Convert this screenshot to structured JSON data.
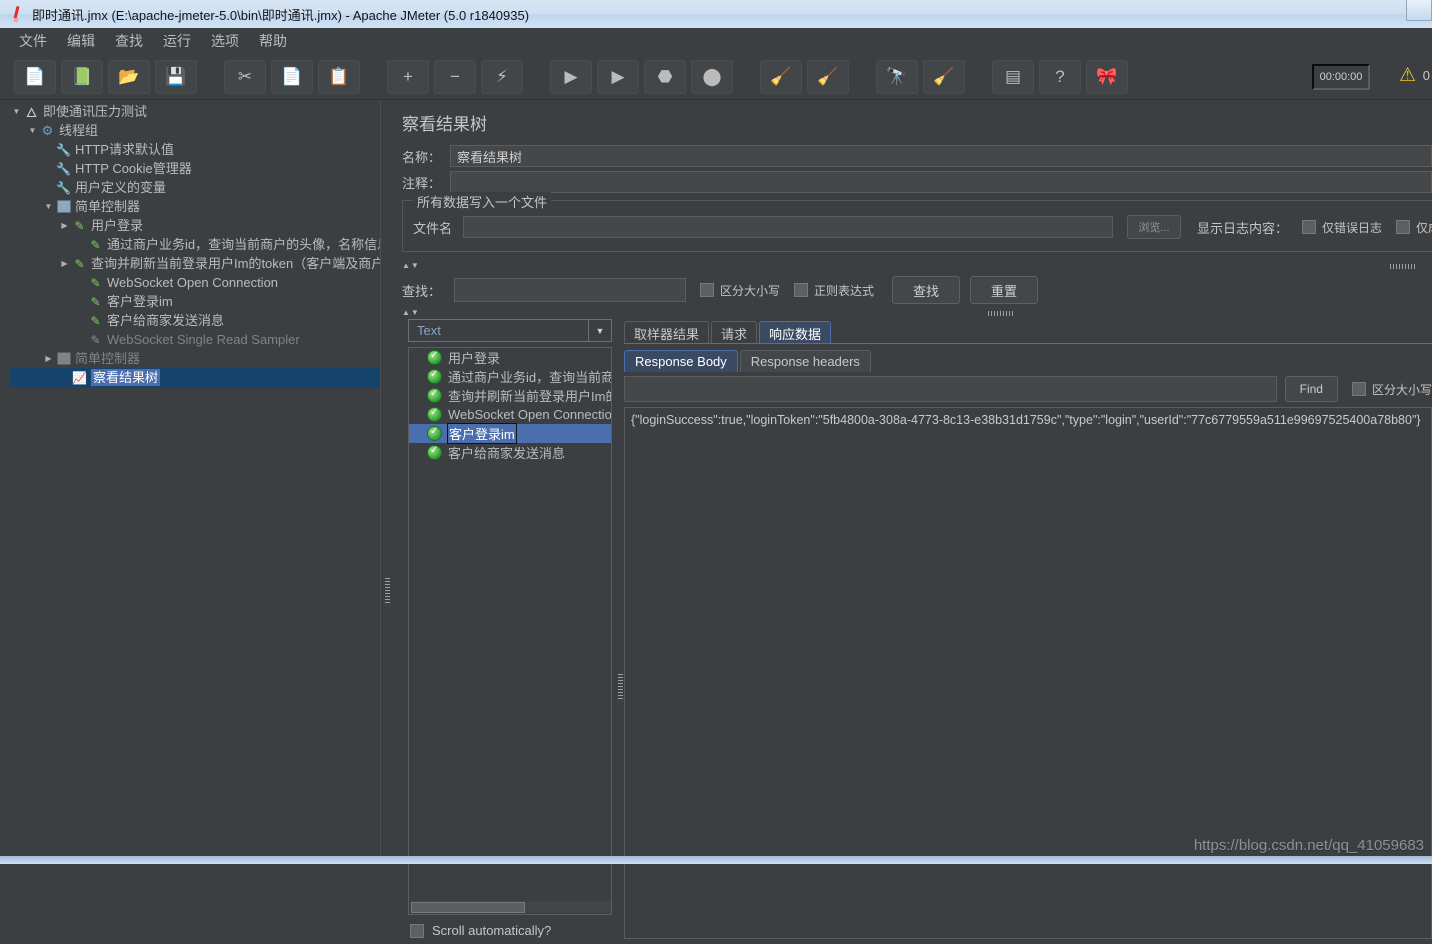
{
  "window": {
    "title": "即时通讯.jmx (E:\\apache-jmeter-5.0\\bin\\即时通讯.jmx) - Apache JMeter (5.0 r1840935)",
    "app_icon": "jmeter-feather-icon"
  },
  "menubar": {
    "items": [
      {
        "label": "文件",
        "name": "menu-file"
      },
      {
        "label": "编辑",
        "name": "menu-edit"
      },
      {
        "label": "查找",
        "name": "menu-search"
      },
      {
        "label": "运行",
        "name": "menu-run"
      },
      {
        "label": "选项",
        "name": "menu-options"
      },
      {
        "label": "帮助",
        "name": "menu-help"
      }
    ]
  },
  "toolbar": {
    "groups": [
      [
        {
          "name": "new-button",
          "icon": "new-document-icon",
          "glyph": "📄"
        },
        {
          "name": "templates-button",
          "icon": "templates-icon",
          "glyph": "📗"
        },
        {
          "name": "open-button",
          "icon": "open-folder-icon",
          "glyph": "📂"
        },
        {
          "name": "save-button",
          "icon": "save-disk-icon",
          "glyph": "💾"
        }
      ],
      [
        {
          "name": "cut-button",
          "icon": "scissors-icon",
          "glyph": "✂"
        },
        {
          "name": "copy-button",
          "icon": "copy-icon",
          "glyph": "📄"
        },
        {
          "name": "paste-button",
          "icon": "clipboard-icon",
          "glyph": "📋"
        }
      ],
      [
        {
          "name": "expand-all-button",
          "icon": "plus-icon",
          "glyph": "+"
        },
        {
          "name": "collapse-all-button",
          "icon": "minus-icon",
          "glyph": "−"
        },
        {
          "name": "toggle-button",
          "icon": "toggle-icon",
          "glyph": "⚡"
        }
      ],
      [
        {
          "name": "start-button",
          "icon": "play-icon",
          "glyph": "▶"
        },
        {
          "name": "start-no-pauses-button",
          "icon": "play-no-pause-icon",
          "glyph": "▶"
        },
        {
          "name": "stop-button",
          "icon": "stop-icon",
          "glyph": "⬣"
        },
        {
          "name": "shutdown-button",
          "icon": "shutdown-icon",
          "glyph": "⬤"
        }
      ],
      [
        {
          "name": "clear-button",
          "icon": "broom-gear-icon",
          "glyph": "🧹"
        },
        {
          "name": "clear-all-button",
          "icon": "broom-gear-all-icon",
          "glyph": "🧹"
        }
      ],
      [
        {
          "name": "search-button",
          "icon": "binoculars-icon",
          "glyph": "🔭"
        },
        {
          "name": "search-reset-button",
          "icon": "yellow-broom-icon",
          "glyph": "🧹"
        }
      ],
      [
        {
          "name": "function-helper-button",
          "icon": "list-plus-icon",
          "glyph": "▤"
        },
        {
          "name": "help-button",
          "icon": "help-book-icon",
          "glyph": "?"
        },
        {
          "name": "undo-button",
          "icon": "ribbon-icon",
          "glyph": "🎀"
        }
      ]
    ],
    "timer": "00:00:00",
    "warning_icon": "warning-triangle-icon",
    "warning_count": "0"
  },
  "tree": {
    "nodes": [
      {
        "label": "即使通讯压力测试",
        "indent": 0,
        "twist": "▼",
        "icon": "test-plan-icon",
        "icon_class": "ic-shaker",
        "glyph": "🜂",
        "dim": false,
        "selected": false
      },
      {
        "label": "线程组",
        "indent": 1,
        "twist": "▼",
        "icon": "thread-group-icon",
        "icon_class": "ic-gear",
        "glyph": "⚙",
        "dim": false,
        "selected": false
      },
      {
        "label": "HTTP请求默认值",
        "indent": 2,
        "twist": "",
        "icon": "config-element-icon",
        "icon_class": "ic-wrench",
        "glyph": "🔧",
        "dim": false,
        "selected": false
      },
      {
        "label": "HTTP Cookie管理器",
        "indent": 2,
        "twist": "",
        "icon": "config-element-icon",
        "icon_class": "ic-wrench",
        "glyph": "🔧",
        "dim": false,
        "selected": false
      },
      {
        "label": "用户定义的变量",
        "indent": 2,
        "twist": "",
        "icon": "config-element-icon",
        "icon_class": "ic-wrench",
        "glyph": "🔧",
        "dim": false,
        "selected": false
      },
      {
        "label": "简单控制器",
        "indent": 2,
        "twist": "▼",
        "icon": "simple-controller-icon",
        "icon_class": "ic-ctrl",
        "glyph": "",
        "dim": false,
        "selected": false
      },
      {
        "label": "用户登录",
        "indent": 3,
        "twist": "▶",
        "icon": "sampler-icon",
        "icon_class": "ic-pen",
        "glyph": "✎",
        "dim": false,
        "selected": false
      },
      {
        "label": "通过商户业务id，查询当前商户的头像，名称信息",
        "indent": 4,
        "twist": "",
        "icon": "sampler-icon",
        "icon_class": "ic-pen",
        "glyph": "✎",
        "dim": false,
        "selected": false
      },
      {
        "label": "查询并刷新当前登录用户Im的token（客户端及商户端）",
        "indent": 3,
        "twist": "▶",
        "icon": "sampler-icon",
        "icon_class": "ic-pen",
        "glyph": "✎",
        "dim": false,
        "selected": false
      },
      {
        "label": "WebSocket Open Connection",
        "indent": 4,
        "twist": "",
        "icon": "sampler-icon",
        "icon_class": "ic-pen",
        "glyph": "✎",
        "dim": false,
        "selected": false
      },
      {
        "label": "客户登录im",
        "indent": 4,
        "twist": "",
        "icon": "sampler-icon",
        "icon_class": "ic-pen",
        "glyph": "✎",
        "dim": false,
        "selected": false
      },
      {
        "label": "客户给商家发送消息",
        "indent": 4,
        "twist": "",
        "icon": "sampler-icon",
        "icon_class": "ic-pen",
        "glyph": "✎",
        "dim": false,
        "selected": false
      },
      {
        "label": "WebSocket Single Read Sampler",
        "indent": 4,
        "twist": "",
        "icon": "sampler-disabled-icon",
        "icon_class": "ic-pen g",
        "glyph": "✎",
        "dim": true,
        "selected": false
      },
      {
        "label": "简单控制器",
        "indent": 2,
        "twist": "▶",
        "icon": "simple-controller-disabled-icon",
        "icon_class": "ic-ctrl g",
        "glyph": "",
        "dim": true,
        "selected": false
      },
      {
        "label": "察看结果树",
        "indent": 3,
        "twist": "",
        "icon": "view-results-tree-icon",
        "icon_class": "ic-chart",
        "glyph": "📈",
        "dim": false,
        "selected": true
      }
    ]
  },
  "panel": {
    "title": "察看结果树",
    "name_label": "名称：",
    "name_value": "察看结果树",
    "comment_label": "注释：",
    "comment_value": "",
    "filegroup": {
      "legend": "所有数据写入一个文件",
      "filename_label": "文件名",
      "filename_value": "",
      "browse_label": "浏览...",
      "log_display_label": "显示日志内容：",
      "checkboxes": [
        {
          "label": "仅错误日志",
          "name": "errors-only-checkbox",
          "checked": false
        },
        {
          "label": "仅成功日",
          "name": "successes-only-checkbox",
          "checked": false
        }
      ]
    },
    "search": {
      "label": "查找：",
      "value": "",
      "case_sensitive_label": "区分大小写",
      "regex_label": "正则表达式",
      "search_button": "查找",
      "reset_button": "重置"
    }
  },
  "results": {
    "render_selector": "Text",
    "items": [
      {
        "label": "用户登录",
        "status": "success",
        "selected": false
      },
      {
        "label": "通过商户业务id，查询当前商户",
        "status": "success",
        "selected": false
      },
      {
        "label": "查询并刷新当前登录用户Im的",
        "status": "success",
        "selected": false
      },
      {
        "label": "WebSocket Open Connection",
        "status": "success",
        "selected": false
      },
      {
        "label": "客户登录im",
        "status": "success",
        "selected": true
      },
      {
        "label": "客户给商家发送消息",
        "status": "success",
        "selected": false
      }
    ],
    "scroll_label": "Scroll automatically?",
    "scroll_checked": false
  },
  "detail": {
    "tabs": [
      {
        "label": "取样器结果",
        "name": "tab-sampler-result",
        "active": false
      },
      {
        "label": "请求",
        "name": "tab-request",
        "active": false
      },
      {
        "label": "响应数据",
        "name": "tab-response-data",
        "active": true
      }
    ],
    "subtabs": [
      {
        "label": "Response Body",
        "name": "subtab-response-body",
        "active": true
      },
      {
        "label": "Response headers",
        "name": "subtab-response-headers",
        "active": false
      }
    ],
    "find_value": "",
    "find_button": "Find",
    "find_case_label": "区分大小写",
    "response_body": "{\"loginSuccess\":true,\"loginToken\":\"5fb4800a-308a-4773-8c13-e38b31d1759c\",\"type\":\"login\",\"userId\":\"77c6779559a511e99697525400a78b80\"}"
  },
  "watermark": "https://blog.csdn.net/qq_41059683"
}
